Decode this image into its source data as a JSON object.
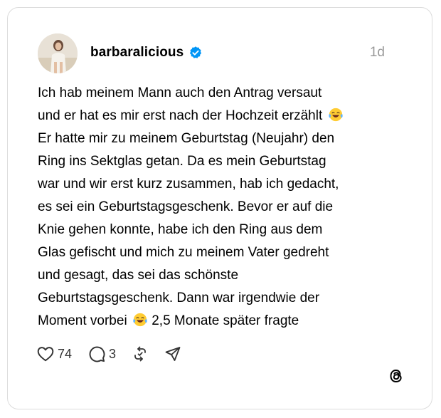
{
  "post": {
    "username": "barbaralicious",
    "timestamp": "1d",
    "lines": [
      {
        "text": "Ich hab meinem Mann auch den Antrag versaut",
        "emoji": null
      },
      {
        "text": "und er hat es mir erst nach der Hochzeit erzählt ",
        "emoji": "face-with-tears-of-joy"
      },
      {
        "text": "Er hatte mir zu meinem Geburtstag (Neujahr) den",
        "emoji": null
      },
      {
        "text": "Ring ins Sektglas getan. Da es mein Geburtstag",
        "emoji": null
      },
      {
        "text": "war und wir erst kurz zusammen, hab ich gedacht,",
        "emoji": null
      },
      {
        "text": "es sei ein Geburtstagsgeschenk. Bevor er auf die",
        "emoji": null
      },
      {
        "text": "Knie gehen konnte, habe ich den Ring aus dem",
        "emoji": null
      },
      {
        "text": "Glas gefischt und mich zu meinem Vater gedreht",
        "emoji": null
      },
      {
        "text": "und gesagt, das sei das schönste",
        "emoji": null
      },
      {
        "text": "Geburtstagsgeschenk. Dann war irgendwie der",
        "emoji": null
      }
    ],
    "last_line": {
      "before": "Moment vorbei ",
      "emoji": "face-with-tears-of-joy",
      "after": " 2,5 Monate später fragte"
    }
  },
  "actions": {
    "likes": "74",
    "replies": "3",
    "like_icon": "heart-icon",
    "reply_icon": "comment-icon",
    "repost_icon": "repost-icon",
    "share_icon": "send-icon"
  },
  "branding": {
    "logo_icon": "threads-logo-icon"
  },
  "colors": {
    "verified_blue": "#0095f6",
    "timestamp_gray": "#999999",
    "border": "#dcdcdc"
  }
}
